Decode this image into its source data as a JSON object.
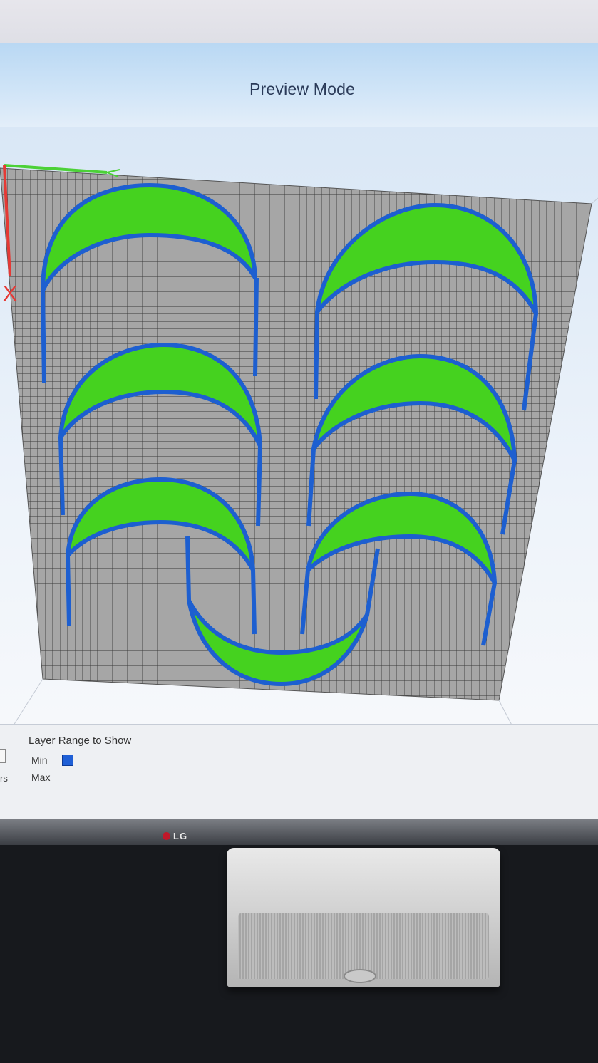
{
  "window": {
    "title": "Preview Mode"
  },
  "viewport": {
    "axis": {
      "x_label": "X",
      "x_color": "#e53935",
      "y_color": "#4cd137"
    },
    "colors": {
      "bed": "#a6a6a6",
      "grid_line": "#383838",
      "perimeter": "#1d5fd0",
      "infill": "#45d21f"
    }
  },
  "layer_range": {
    "header": "Layer Range to Show",
    "min_label": "Min",
    "max_label": "Max",
    "side_text": "rs",
    "handle_color": "#1f5fd6"
  },
  "monitor": {
    "brand": "LG"
  }
}
